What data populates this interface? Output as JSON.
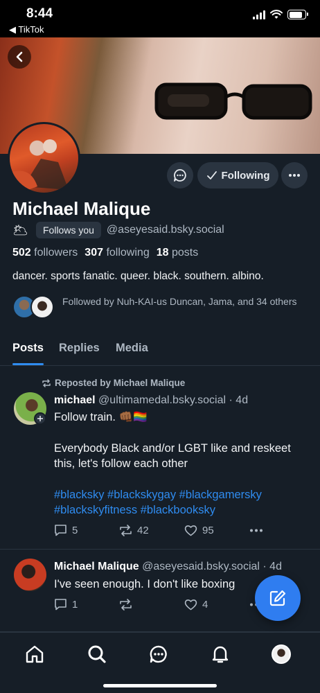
{
  "status_bar": {
    "time": "8:44",
    "back_app": "◀ TikTok",
    "battery_level": 0.85
  },
  "profile": {
    "name": "Michael Malique",
    "follows_you": "Follows you",
    "handle": "@aseyesaid.bsky.social",
    "followers_count": "502",
    "followers_label": "followers",
    "following_count": "307",
    "following_label": "following",
    "posts_count": "18",
    "posts_label": "posts",
    "bio": "dancer. sports fanatic. queer. black. southern. albino.",
    "followed_by": "Followed by Nuh-KAI-us Duncan, Jama, and 34 others",
    "following_button": "Following",
    "sun_emoji": "🌥"
  },
  "tabs": [
    "Posts",
    "Replies",
    "Media"
  ],
  "posts": [
    {
      "repost_label": "Reposted by Michael Malique",
      "author": "michael",
      "handle": "@ultimamedal.bsky.social",
      "time": "· 4d",
      "line1": "Follow train. 👊🏾🏳️‍🌈",
      "line2": "Everybody Black and/or LGBT like and reskeet this, let's follow each other",
      "tags_line1": "#blacksky #blackskygay #blackgamersky",
      "tags_line2": "#blackskyfitness #blackbooksky",
      "replies": "5",
      "reposts": "42",
      "likes": "95"
    },
    {
      "author": "Michael Malique",
      "handle": "@aseyesaid.bsky.social",
      "time": "· 4d",
      "text": "I've seen enough. I don't like boxing",
      "replies": "1",
      "likes": "4"
    }
  ],
  "colors": {
    "background": "#161e27",
    "accent": "#2f8cf0",
    "surface": "#2a3440",
    "muted": "#aeb8c3"
  }
}
